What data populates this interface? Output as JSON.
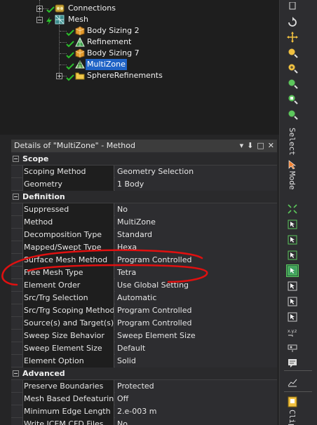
{
  "tree": {
    "nodes": [
      {
        "label": "Connections",
        "icon": "connections-icon"
      },
      {
        "label": "Mesh",
        "icon": "mesh-icon"
      },
      {
        "label": "Body Sizing 2",
        "icon": "body-sizing-icon"
      },
      {
        "label": "Refinement",
        "icon": "refinement-icon"
      },
      {
        "label": "Body Sizing 7",
        "icon": "body-sizing-icon"
      },
      {
        "label": "MultiZone",
        "icon": "multizone-icon",
        "selected": true
      },
      {
        "label": "SphereRefinements",
        "icon": "folder-icon"
      }
    ]
  },
  "details": {
    "title": "Details of \"MultiZone\" - Method",
    "tools": {
      "dropdown": "▾",
      "pin": "⬇",
      "float": "□",
      "close": "✕"
    },
    "sections": [
      {
        "label": "Scope",
        "rows": [
          {
            "name": "Scoping Method",
            "value": "Geometry Selection"
          },
          {
            "name": "Geometry",
            "value": "1 Body"
          }
        ]
      },
      {
        "label": "Definition",
        "rows": [
          {
            "name": "Suppressed",
            "value": "No"
          },
          {
            "name": "Method",
            "value": "MultiZone"
          },
          {
            "name": "Decomposition Type",
            "value": "Standard"
          },
          {
            "name": "Mapped/Swept Type",
            "value": "Hexa"
          },
          {
            "name": "Surface Mesh Method",
            "value": "Program Controlled"
          },
          {
            "name": "Free Mesh Type",
            "value": "Tetra"
          },
          {
            "name": "Element Order",
            "value": "Use Global Setting"
          },
          {
            "name": "Src/Trg Selection",
            "value": "Automatic"
          },
          {
            "name": "Src/Trg Scoping Method",
            "value": "Program Controlled"
          },
          {
            "name": "Source(s) and Target(s)",
            "value": "Program Controlled"
          },
          {
            "name": "Sweep Size Behavior",
            "value": "Sweep Element Size"
          },
          {
            "name": "Sweep Element Size",
            "value": "Default"
          },
          {
            "name": "Element Option",
            "value": "Solid"
          }
        ]
      },
      {
        "label": "Advanced",
        "rows": [
          {
            "name": "Preserve Boundaries",
            "value": "Protected"
          },
          {
            "name": "Mesh Based Defeaturing",
            "value": "Off"
          },
          {
            "name": "Minimum Edge Length",
            "value": "2.e-003 m"
          },
          {
            "name": "Write ICEM CFD Files",
            "value": "No"
          }
        ]
      }
    ]
  },
  "right_toolbar": {
    "select_label": "Select",
    "mode_label": "Mode",
    "clip_label": "Clip",
    "icons": [
      "rotate-icon",
      "pan-icon",
      "zoom-icon",
      "zoom-box-icon",
      "zoom-fit-icon",
      "zoom-selection-icon",
      "zoom-extents-icon"
    ]
  },
  "colors": {
    "selection": "#1f63c6",
    "annotation": "#e01010",
    "panel_bg": "#2d2d30",
    "tree_bg": "#1e1e1e"
  }
}
